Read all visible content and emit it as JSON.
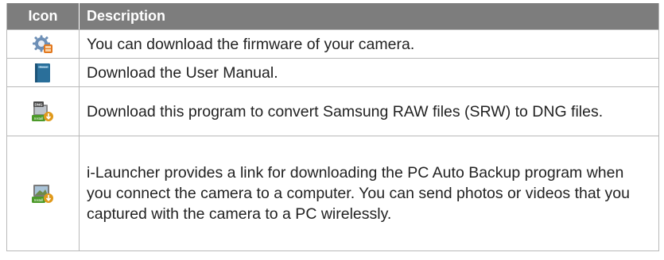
{
  "header": {
    "icon_col": "Icon",
    "desc_col": "Description"
  },
  "rows": [
    {
      "icon": "firmware-gear-icon",
      "description": "You can download the firmware of your camera."
    },
    {
      "icon": "user-manual-book-icon",
      "icon_text": "Manual",
      "description": "Download the User Manual."
    },
    {
      "icon": "dng-converter-install-icon",
      "icon_text": "DNG",
      "icon_subtext": "Install",
      "description": "Download this program to convert Samsung RAW files (SRW) to DNG files."
    },
    {
      "icon": "pc-auto-backup-install-icon",
      "icon_subtext": "Install",
      "description": "i-Launcher provides a link for downloading the PC Auto Backup program when you connect the camera to a computer. You can send photos or videos that you captured with the camera to a PC wirelessly."
    }
  ],
  "colors": {
    "header_bg": "#7d7d7d",
    "border": "#b9b9b9",
    "install_green": "#4c9a2a",
    "manual_blue": "#2a6f9a"
  }
}
